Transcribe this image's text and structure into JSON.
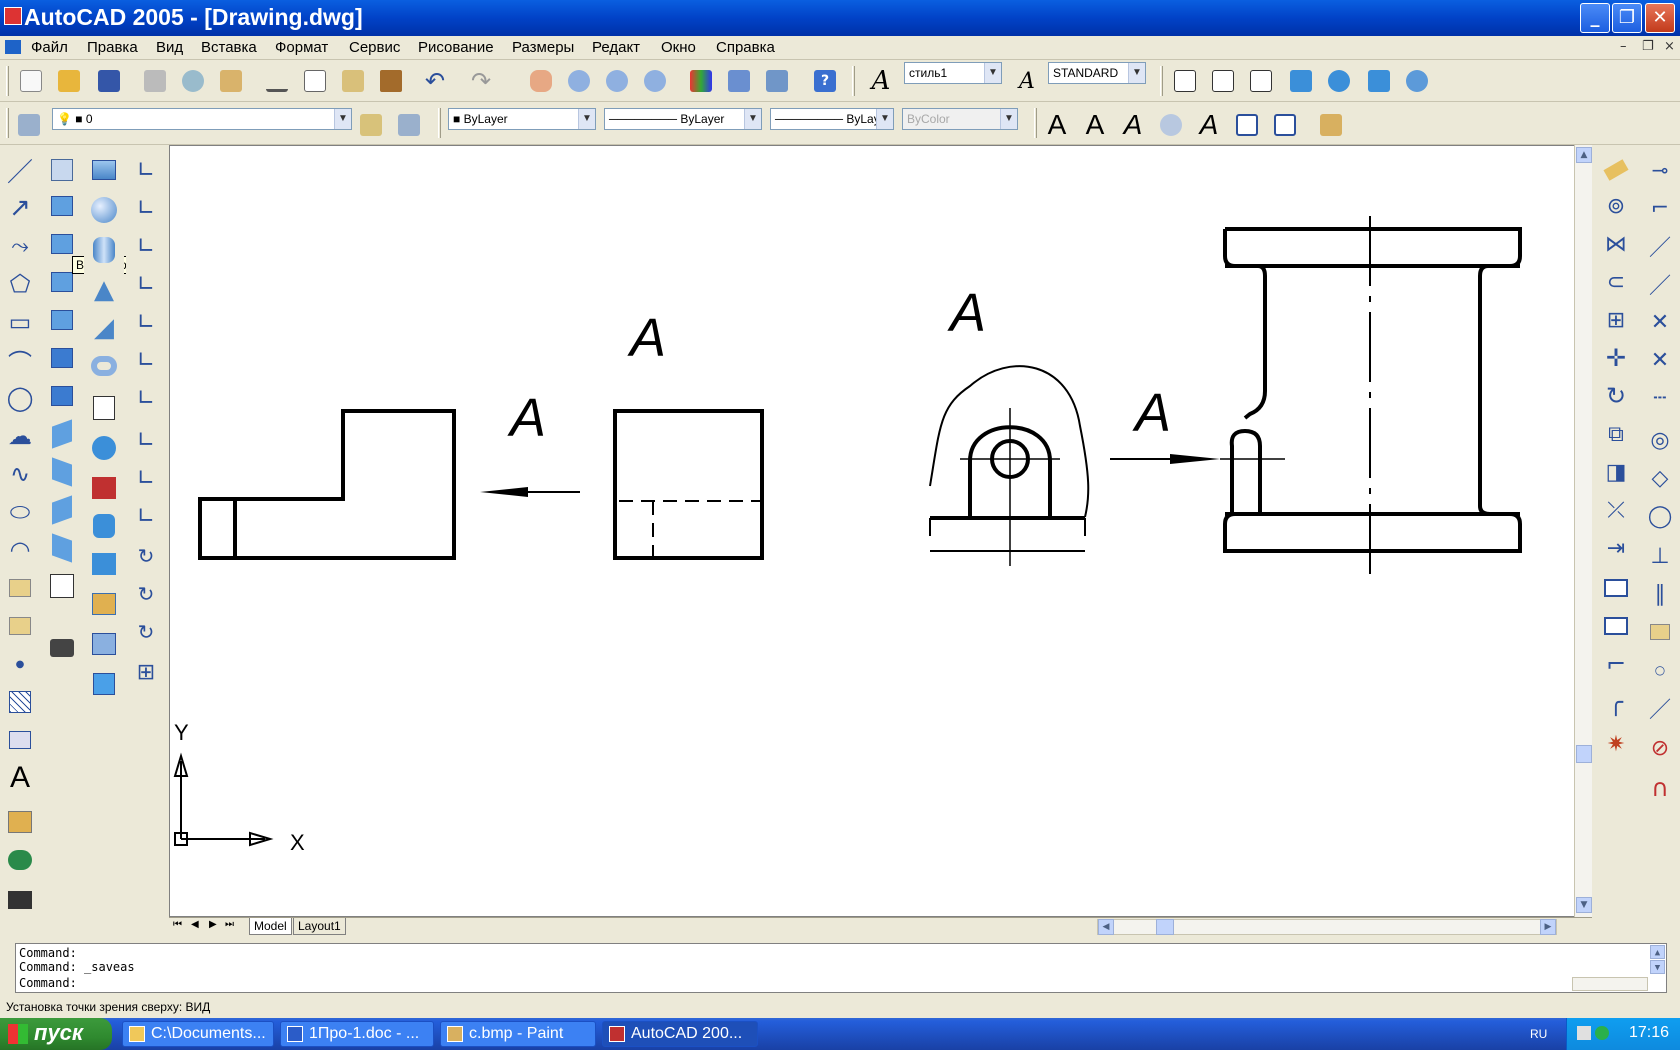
{
  "window": {
    "title": "AutoCAD 2005 - [Drawing.dwg]",
    "minimize": "_",
    "maximize": "❐",
    "close": "✕"
  },
  "menu": [
    "Файл",
    "Правка",
    "Вид",
    "Вставка",
    "Формат",
    "Сервис",
    "Рисование",
    "Размеры",
    "Редакт",
    "Окно",
    "Справка"
  ],
  "mdi_controls": [
    "–",
    "❐",
    "×"
  ],
  "styles_toolbar": {
    "text_style": "стиль1",
    "dim_style": "STANDARD"
  },
  "properties_toolbar": {
    "layer": "0",
    "color": "ByLayer",
    "linetype": "ByLayer",
    "lineweight": "ByLayer",
    "plotstyle": "ByColor"
  },
  "tooltip": "Вид сверху",
  "drawing": {
    "labels": [
      "A",
      "A",
      "A",
      "A"
    ],
    "ucs_x": "X",
    "ucs_y": "Y"
  },
  "tabs": [
    "Model",
    "Layout1"
  ],
  "command_lines": [
    "Command:",
    "Command: _saveas",
    "Command:"
  ],
  "status_text": "Установка точки зрения сверху:  ВИД",
  "taskbar": {
    "start": "пуск",
    "tasks": [
      "C:\\Documents...",
      "1Про-1.doc - ...",
      "c.bmp - Paint",
      "AutoCAD 200..."
    ],
    "language": "RU",
    "clock": "17:16"
  },
  "colors": {
    "titlebar": "#0142c7",
    "canvas": "#ffffff",
    "toolbar": "#ece9d8",
    "taskbar": "#245edb",
    "start": "#2f8a2f"
  }
}
